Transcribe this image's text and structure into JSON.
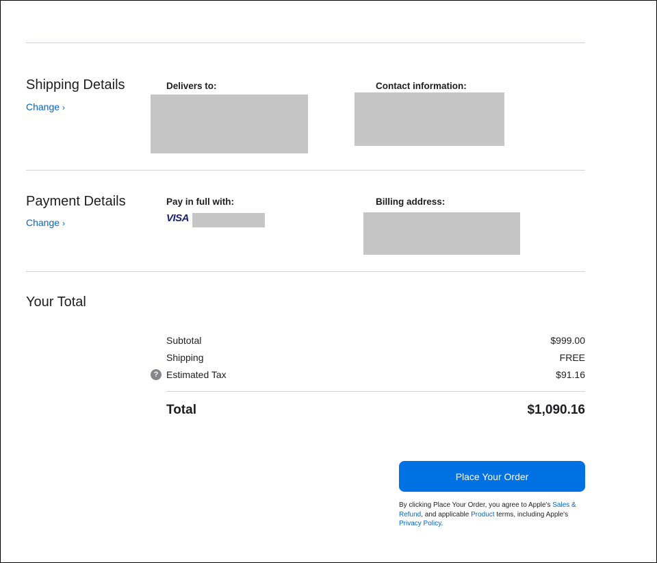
{
  "shipping": {
    "title": "Shipping Details",
    "change_label": "Change",
    "delivers_to_label": "Delivers to:",
    "contact_label": "Contact information:"
  },
  "payment": {
    "title": "Payment Details",
    "change_label": "Change",
    "pay_label": "Pay in full with:",
    "card_brand": "VISA",
    "billing_label": "Billing address:"
  },
  "total": {
    "title": "Your Total",
    "subtotal_label": "Subtotal",
    "subtotal_value": "$999.00",
    "shipping_label": "Shipping",
    "shipping_value": "FREE",
    "tax_label": "Estimated Tax",
    "tax_value": "$91.16",
    "total_label": "Total",
    "total_value": "$1,090.16"
  },
  "order": {
    "button_label": "Place Your Order",
    "legal_prefix": "By clicking Place Your Order, you agree to Apple's ",
    "legal_link_1": "Sales & Refund",
    "legal_mid": ", and applicable ",
    "legal_link_2": "Product",
    "legal_mid_2": " terms, including Apple's ",
    "legal_link_3": "Privacy Policy",
    "legal_suffix": "."
  },
  "icons": {
    "help": "?",
    "chevron": "›"
  },
  "colors": {
    "accent": "#0071e3",
    "link": "#0066cc",
    "redaction": "#c5c5c5"
  }
}
